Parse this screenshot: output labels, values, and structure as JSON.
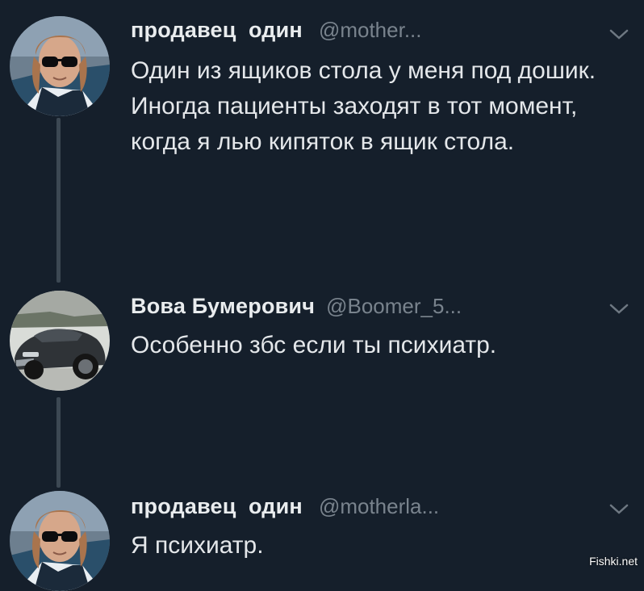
{
  "tweets": [
    {
      "name": "продавец  один",
      "handle": "@mother...",
      "text": "Один из ящиков стола у меня под дошик. Иногда пациенты заходят в тот момент, когда я лью кипяток в ящик стола.",
      "avatar_icon": "person-sunglasses-avatar"
    },
    {
      "name": "Вова Бумерович",
      "handle": "@Boomer_5...",
      "text": "Особенно збс если ты психиатр.",
      "avatar_icon": "car-avatar"
    },
    {
      "name": "продавец  один",
      "handle": "@motherla...",
      "text": "Я психиатр.",
      "avatar_icon": "person-sunglasses-avatar"
    }
  ],
  "watermark": "Fishki.net",
  "colors": {
    "background": "#151f2b",
    "thread_line": "#3c4853",
    "handle": "#79838d",
    "text": "#e4e7ea"
  }
}
